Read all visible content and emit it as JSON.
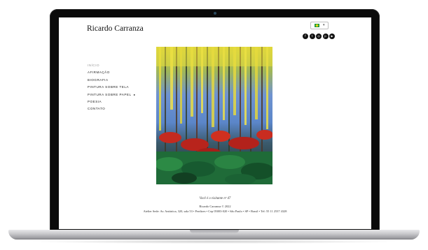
{
  "site": {
    "title": "Ricardo Carranza"
  },
  "language": {
    "selected_flag": "flag-brazil-icon"
  },
  "social_icons": [
    "facebook-icon",
    "twitter-icon",
    "instagram-icon",
    "pinterest-icon",
    "youtube-icon"
  ],
  "nav": {
    "items": [
      {
        "label": "INÍCIO",
        "active": true
      },
      {
        "label": "AFIRMAÇÃO"
      },
      {
        "label": "BIOGRAFIA"
      },
      {
        "label": "PINTURA SOBRE TELA"
      },
      {
        "label": "PINTURA SOBRE PAPEL",
        "has_submenu": true,
        "submenu_marker": "●"
      },
      {
        "label": "POESIA"
      },
      {
        "label": "CONTATO"
      }
    ]
  },
  "footer": {
    "visitor_text": "Você é o visitante nº 47",
    "copyright": "Ricardo Carranza © 2022",
    "address": "Atelier Sede: Av. Antártica, 320, sala 53 • Perdizes • Cep 05003-020 • São Paulo • SP • Brasil • Tel: 55 11 2537 4328"
  },
  "colors": {
    "painting_sky": "#5f8fd6",
    "painting_yellow": "#e6d93a",
    "painting_red": "#c8251f",
    "painting_green": "#1f7a3d"
  }
}
